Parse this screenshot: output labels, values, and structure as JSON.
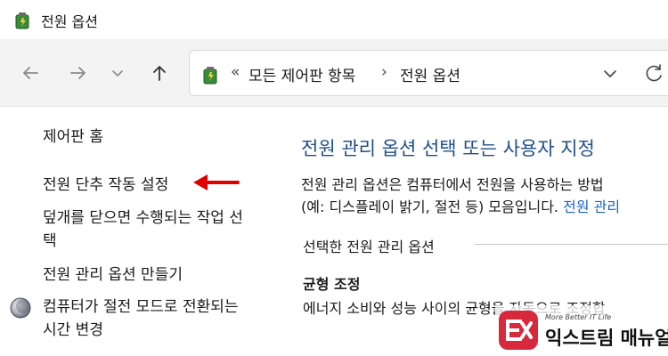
{
  "window": {
    "title": "전원 옵션",
    "icon": "power-options-battery-icon"
  },
  "navigation": {
    "back_icon": "arrow-left-icon",
    "forward_icon": "arrow-right-icon",
    "recent_icon": "chevron-down-icon",
    "up_icon": "arrow-up-icon"
  },
  "address_bar": {
    "overflow_glyph": "«",
    "crumbs": [
      "모든 제어판 항목",
      "전원 옵션"
    ],
    "separator": "›",
    "dropdown_icon": "chevron-down-icon",
    "refresh_icon": "refresh-icon"
  },
  "sidebar": {
    "items": [
      {
        "label": "제어판 홈"
      },
      {
        "label": "전원 단추 작동 설정"
      },
      {
        "label": "덮개를 닫으면 수행되는 작업 선택"
      },
      {
        "label": "전원 관리 옵션 만들기"
      },
      {
        "label": "컴퓨터가 절전 모드로 전환되는 시간 변경",
        "icon": "moon-sleep-icon"
      }
    ]
  },
  "main": {
    "title": "전원 관리 옵션 선택 또는 사용자 지정",
    "description_line1": "전원 관리 옵션은 컴퓨터에서 전원을 사용하는 방법",
    "description_line2": "(예: 디스플레이 밝기, 절전 등) 모음입니다. ",
    "description_link": "전원 관리",
    "section_label": "선택한 전원 관리 옵션",
    "plan_name": "균형 조정",
    "plan_description": "에너지 소비와 성능 사이의 균형을 자동으로 조정합"
  },
  "annotation": {
    "arrow_color": "#e00000"
  },
  "watermark": {
    "logo_text": "EX",
    "tagline": "More Better IT Life",
    "name": "익스트림 매뉴얼",
    "brand_color": "#d8283c"
  }
}
